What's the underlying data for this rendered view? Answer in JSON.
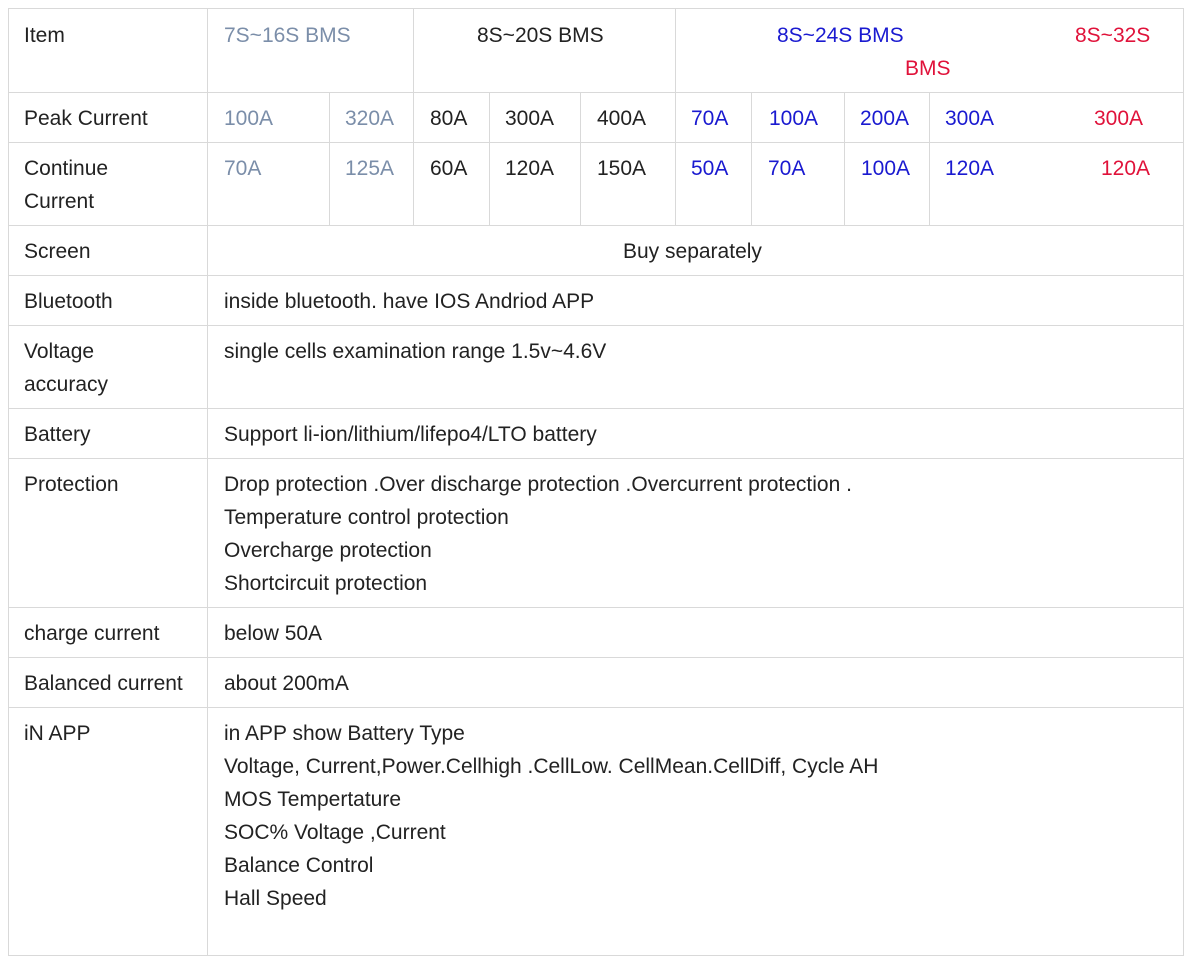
{
  "colors": {
    "group_a": "#7b8ea9",
    "group_b": "#222222",
    "group_c": "#1a1ad0",
    "group_d": "#e0123a",
    "border": "#d9d9d9"
  },
  "header": {
    "item_label": "Item",
    "group_a": "7S~16S BMS",
    "group_b": "8S~20S BMS",
    "group_c": "8S~24S BMS",
    "group_d_line1": "8S~32S",
    "group_d_line2": "BMS"
  },
  "peak": {
    "label": "Peak Current",
    "values": [
      "100A",
      "320A",
      "80A",
      "300A",
      "400A",
      "70A",
      "100A",
      "200A",
      "300A",
      "300A"
    ]
  },
  "continue": {
    "label_line1": "Continue",
    "label_line2": "Current",
    "values": [
      "70A",
      "125A",
      "60A",
      "120A",
      "150A",
      "50A",
      "70A",
      "100A",
      "120A",
      "120A"
    ]
  },
  "screen": {
    "label": "Screen",
    "value": "Buy separately"
  },
  "bluetooth": {
    "label": "Bluetooth",
    "value": "inside bluetooth. have IOS Andriod APP"
  },
  "voltage": {
    "label_line1": "Voltage",
    "label_line2": "accuracy",
    "value": "single cells examination range 1.5v~4.6V"
  },
  "battery": {
    "label": "Battery",
    "value": "Support li-ion/lithium/lifepo4/LTO battery"
  },
  "protection": {
    "label": "Protection",
    "lines": [
      "Drop protection .Over discharge protection .Overcurrent protection .",
      "Temperature control protection",
      "Overcharge protection",
      "Shortcircuit protection"
    ]
  },
  "charge": {
    "label": "charge current",
    "value": "below 50A"
  },
  "balanced": {
    "label": "Balanced current",
    "value": "about 200mA"
  },
  "app": {
    "label": "iN APP",
    "lines": [
      "in APP show Battery Type",
      "Voltage, Current,Power.Cellhigh .CellLow. CellMean.CellDiff, Cycle AH",
      "MOS Tempertature",
      "SOC% Voltage ,Current",
      "Balance Control",
      "Hall Speed"
    ]
  }
}
